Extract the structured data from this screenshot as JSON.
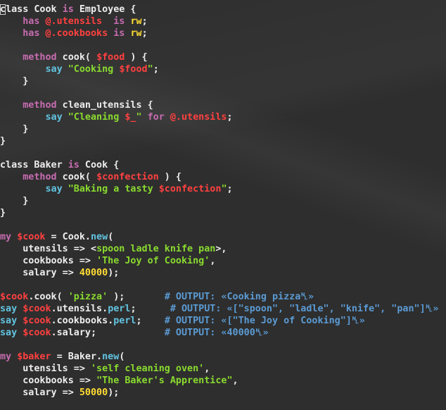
{
  "code_lines": [
    [
      [
        "c",
        "pl cursor"
      ],
      [
        "lass Cook ",
        "pl"
      ],
      [
        "is",
        "kw"
      ],
      [
        " Employee {",
        "pl"
      ]
    ],
    [
      [
        "    ",
        "pl"
      ],
      [
        "has",
        "kw"
      ],
      [
        " ",
        "pl"
      ],
      [
        "@.utensils",
        "var"
      ],
      [
        "  ",
        "pl"
      ],
      [
        "is",
        "kw"
      ],
      [
        " ",
        "pl"
      ],
      [
        "rw",
        "num"
      ],
      [
        ";",
        "pl"
      ]
    ],
    [
      [
        "    ",
        "pl"
      ],
      [
        "has",
        "kw"
      ],
      [
        " ",
        "pl"
      ],
      [
        "@.cookbooks",
        "var"
      ],
      [
        " ",
        "pl"
      ],
      [
        "is",
        "kw"
      ],
      [
        " ",
        "pl"
      ],
      [
        "rw",
        "num"
      ],
      [
        ";",
        "pl"
      ]
    ],
    [
      [
        "",
        "pl"
      ]
    ],
    [
      [
        "    ",
        "pl"
      ],
      [
        "method",
        "kw"
      ],
      [
        " cook( ",
        "pl"
      ],
      [
        "$food",
        "var"
      ],
      [
        " ) {",
        "pl"
      ]
    ],
    [
      [
        "        ",
        "pl"
      ],
      [
        "say",
        "fn"
      ],
      [
        " ",
        "pl"
      ],
      [
        "\"Cooking ",
        "str"
      ],
      [
        "$food",
        "var"
      ],
      [
        "\"",
        "str"
      ],
      [
        ";",
        "pl"
      ]
    ],
    [
      [
        "    }",
        "pl"
      ]
    ],
    [
      [
        "",
        "pl"
      ]
    ],
    [
      [
        "    ",
        "pl"
      ],
      [
        "method",
        "kw"
      ],
      [
        " clean_utensils {",
        "pl"
      ]
    ],
    [
      [
        "        ",
        "pl"
      ],
      [
        "say",
        "fn"
      ],
      [
        " ",
        "pl"
      ],
      [
        "\"Cleaning ",
        "str"
      ],
      [
        "$_",
        "var"
      ],
      [
        "\"",
        "str"
      ],
      [
        " ",
        "pl"
      ],
      [
        "for",
        "kw"
      ],
      [
        " ",
        "pl"
      ],
      [
        "@.utensils",
        "var"
      ],
      [
        ";",
        "pl"
      ]
    ],
    [
      [
        "    }",
        "pl"
      ]
    ],
    [
      [
        "}",
        "pl"
      ]
    ],
    [
      [
        "",
        "pl"
      ]
    ],
    [
      [
        "class Baker ",
        "pl"
      ],
      [
        "is",
        "kw"
      ],
      [
        " Cook {",
        "pl"
      ]
    ],
    [
      [
        "    ",
        "pl"
      ],
      [
        "method",
        "kw"
      ],
      [
        " cook( ",
        "pl"
      ],
      [
        "$confection",
        "var"
      ],
      [
        " ) {",
        "pl"
      ]
    ],
    [
      [
        "        ",
        "pl"
      ],
      [
        "say",
        "fn"
      ],
      [
        " ",
        "pl"
      ],
      [
        "\"Baking a tasty ",
        "str"
      ],
      [
        "$confection",
        "var"
      ],
      [
        "\"",
        "str"
      ],
      [
        ";",
        "pl"
      ]
    ],
    [
      [
        "    }",
        "pl"
      ]
    ],
    [
      [
        "}",
        "pl"
      ]
    ],
    [
      [
        "",
        "pl"
      ]
    ],
    [
      [
        "my",
        "kw"
      ],
      [
        " ",
        "pl"
      ],
      [
        "$cook",
        "var"
      ],
      [
        " = Cook.",
        "pl"
      ],
      [
        "new",
        "fn"
      ],
      [
        "(",
        "pl"
      ]
    ],
    [
      [
        "    utensils => <",
        "pl"
      ],
      [
        "spoon ladle knife pan",
        "str"
      ],
      [
        ">,",
        "pl"
      ]
    ],
    [
      [
        "    cookbooks => ",
        "pl"
      ],
      [
        "'The Joy of Cooking'",
        "str"
      ],
      [
        ",",
        "pl"
      ]
    ],
    [
      [
        "    salary => ",
        "pl"
      ],
      [
        "40000",
        "num"
      ],
      [
        ");",
        "pl"
      ]
    ],
    [
      [
        "",
        "pl"
      ]
    ],
    [
      [
        "$cook",
        "var"
      ],
      [
        ".cook( ",
        "pl"
      ],
      [
        "'pizza'",
        "str"
      ],
      [
        " );       ",
        "pl"
      ],
      [
        "# OUTPUT: «Cooking pizza␤»",
        "cmt"
      ]
    ],
    [
      [
        "say",
        "fn"
      ],
      [
        " ",
        "pl"
      ],
      [
        "$cook",
        "var"
      ],
      [
        ".utensils.",
        "pl"
      ],
      [
        "perl",
        "fn"
      ],
      [
        ";      ",
        "pl"
      ],
      [
        "# OUTPUT: «[\"spoon\", \"ladle\", \"knife\", \"pan\"]␤»",
        "cmt"
      ]
    ],
    [
      [
        "say",
        "fn"
      ],
      [
        " ",
        "pl"
      ],
      [
        "$cook",
        "var"
      ],
      [
        ".cookbooks.",
        "pl"
      ],
      [
        "perl",
        "fn"
      ],
      [
        ";    ",
        "pl"
      ],
      [
        "# OUTPUT: «[\"The Joy of Cooking\"]␤»",
        "cmt"
      ]
    ],
    [
      [
        "say",
        "fn"
      ],
      [
        " ",
        "pl"
      ],
      [
        "$cook",
        "var"
      ],
      [
        ".salary;            ",
        "pl"
      ],
      [
        "# OUTPUT: «40000␤»",
        "cmt"
      ]
    ],
    [
      [
        "",
        "pl"
      ]
    ],
    [
      [
        "my",
        "kw"
      ],
      [
        " ",
        "pl"
      ],
      [
        "$baker",
        "var"
      ],
      [
        " = Baker.",
        "pl"
      ],
      [
        "new",
        "fn"
      ],
      [
        "(",
        "pl"
      ]
    ],
    [
      [
        "    utensils => ",
        "pl"
      ],
      [
        "'self cleaning oven'",
        "str"
      ],
      [
        ",",
        "pl"
      ]
    ],
    [
      [
        "    cookbooks => ",
        "pl"
      ],
      [
        "\"The Baker's Apprentice\"",
        "str"
      ],
      [
        ",",
        "pl"
      ]
    ],
    [
      [
        "    salary => ",
        "pl"
      ],
      [
        "50000",
        "num"
      ],
      [
        ");",
        "pl"
      ]
    ]
  ]
}
